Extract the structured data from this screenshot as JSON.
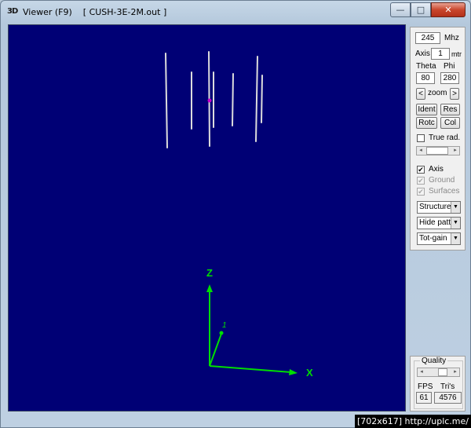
{
  "window": {
    "icon_text": "3D",
    "title": "Viewer (F9)    [ CUSH-3E-2M.out ]",
    "min_glyph": "—",
    "max_glyph": "□",
    "close_glyph": "✕"
  },
  "viewport": {
    "background": "#000075",
    "axes_color": "#00dd00",
    "axis_z_label": "Z",
    "axis_x_label": "X",
    "axis_y_label": "1",
    "center_marker_color": "#cc00cc",
    "element_color": "#dcdcdc"
  },
  "panel": {
    "freq_value": "245",
    "freq_unit": "Mhz",
    "axis_label": "Axis",
    "axis_value": "1",
    "axis_unit": "mtr",
    "theta_label": "Theta",
    "phi_label": "Phi",
    "theta_value": "80",
    "phi_value": "280",
    "zoom_left": "<",
    "zoom_label": "zoom",
    "zoom_right": ">",
    "ident_label": "Ident",
    "res_label": "Res",
    "rotc_label": "Rotc",
    "col_label": "Col",
    "true_rad_label": "True rad.",
    "true_rad_checked": false,
    "axis_check_label": "Axis",
    "axis_checked": true,
    "ground_label": "Ground",
    "ground_checked": true,
    "surfaces_label": "Surfaces",
    "surfaces_checked": true,
    "check_glyph": "✔",
    "select_structure": "Structure",
    "select_pattern": "Hide patt.",
    "select_gain": "Tot-gain",
    "select_arrow": "▼",
    "slider_left": "◂",
    "slider_right": "▸"
  },
  "quality": {
    "label": "Quality",
    "fps_label": "FPS",
    "tris_label": "Tri's",
    "fps_value": "61",
    "tris_value": "4576"
  },
  "watermark": "[702x617] http://uplc.me/"
}
